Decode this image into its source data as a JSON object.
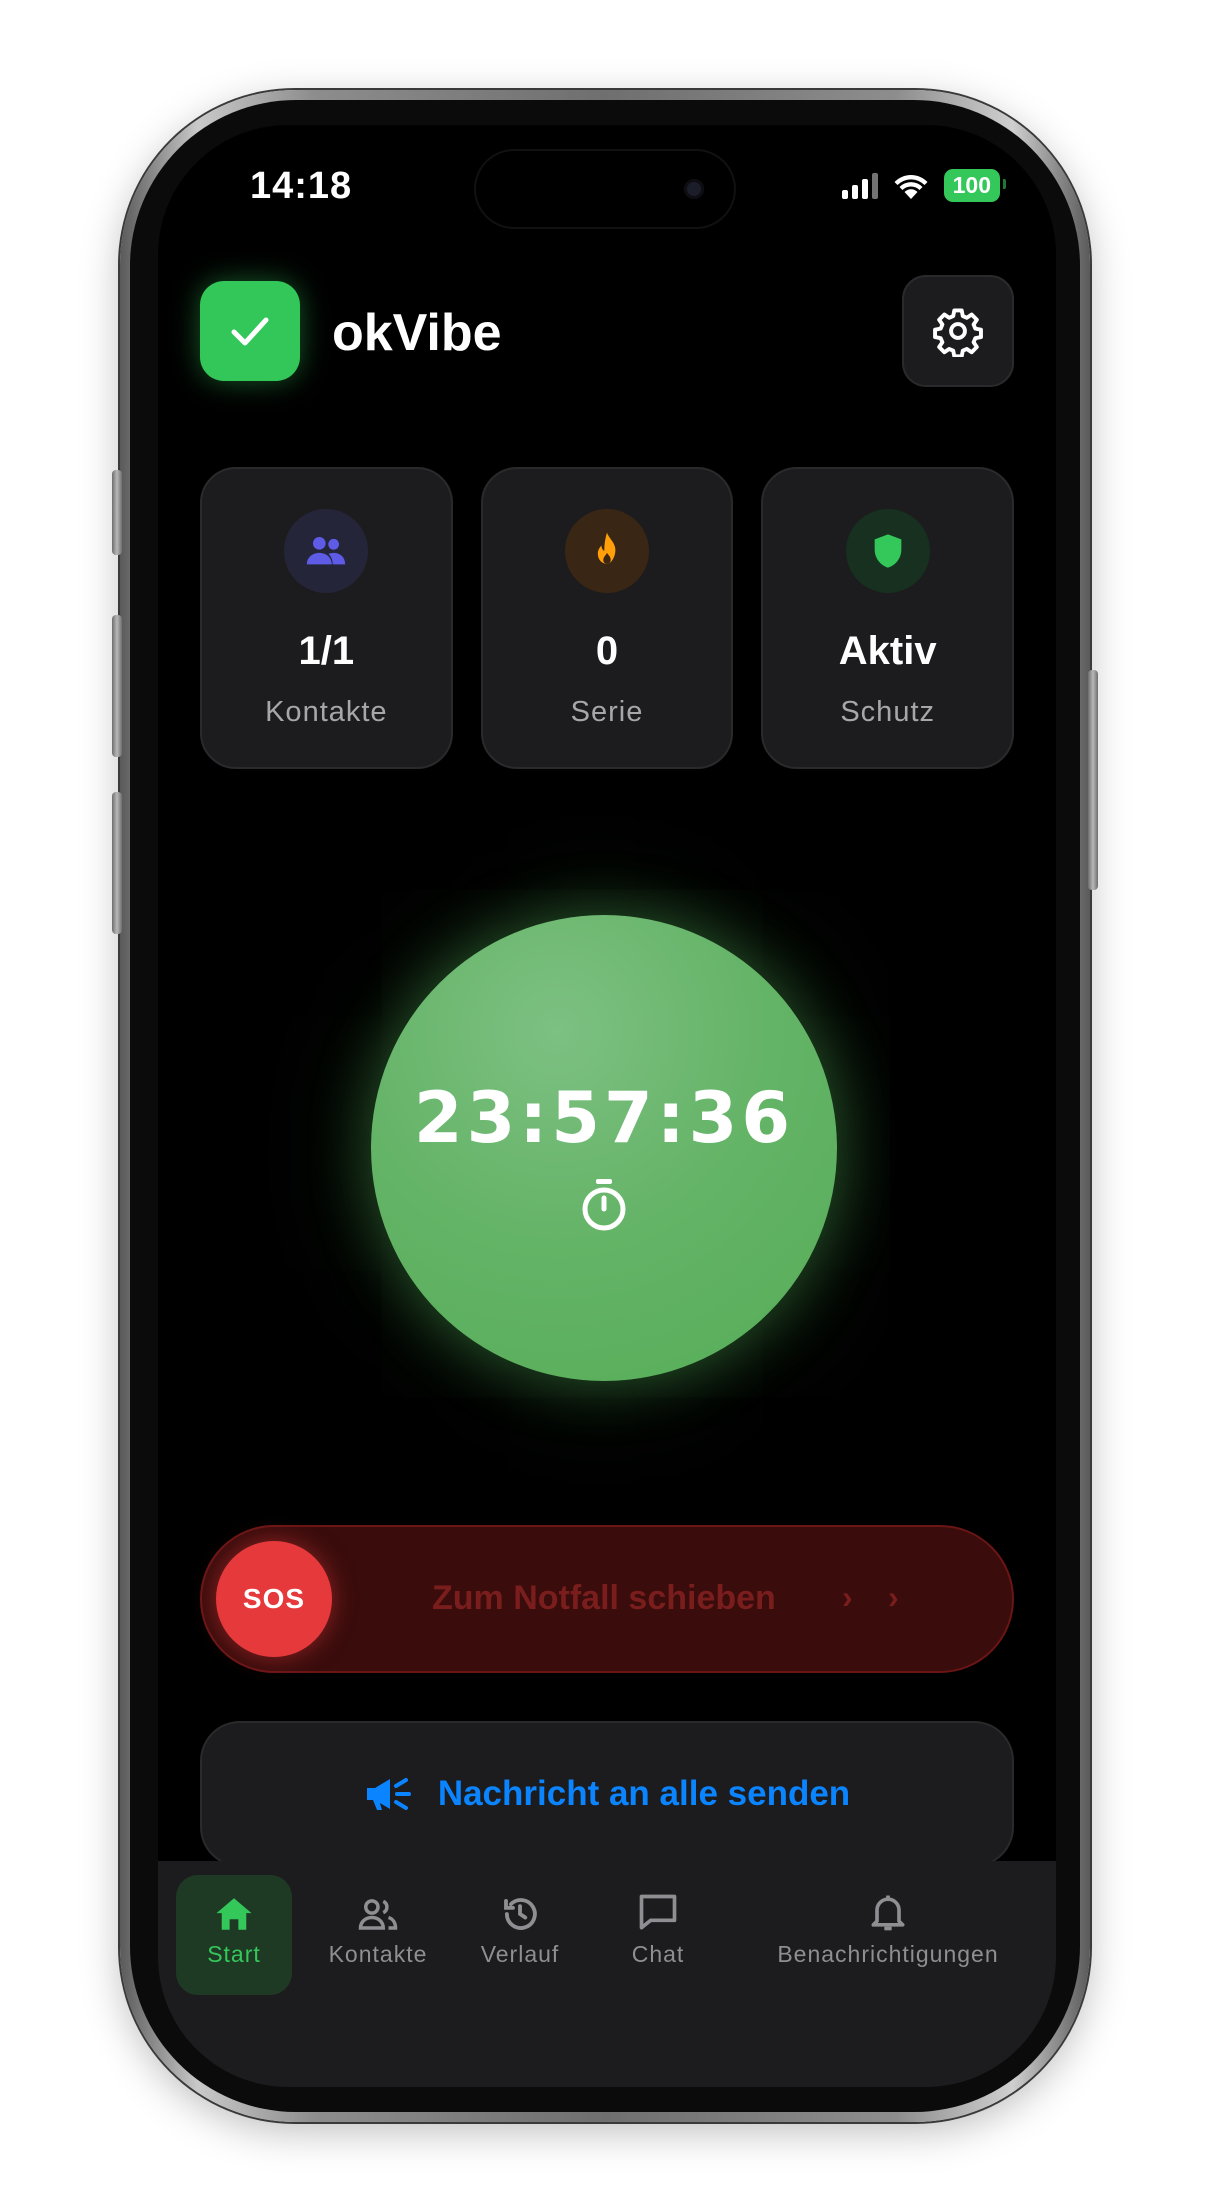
{
  "status_bar": {
    "time": "14:18",
    "battery": "100"
  },
  "header": {
    "app_name": "okVibe"
  },
  "stats": [
    {
      "value": "1/1",
      "label": "Kontakte",
      "icon": "people-icon"
    },
    {
      "value": "0",
      "label": "Serie",
      "icon": "flame-icon"
    },
    {
      "value": "Aktiv",
      "label": "Schutz",
      "icon": "shield-icon"
    }
  ],
  "timer": {
    "countdown": "23:57:36"
  },
  "sos": {
    "knob_label": "SOS",
    "slide_label": "Zum Notfall schieben"
  },
  "broadcast": {
    "label": "Nachricht an alle senden"
  },
  "tabs": [
    {
      "label": "Start",
      "icon": "home-icon",
      "active": true
    },
    {
      "label": "Kontakte",
      "icon": "contacts-icon",
      "active": false
    },
    {
      "label": "Verlauf",
      "icon": "history-icon",
      "active": false
    },
    {
      "label": "Chat",
      "icon": "chat-icon",
      "active": false
    },
    {
      "label": "Benachrichtigungen",
      "icon": "bell-icon",
      "active": false
    }
  ],
  "colors": {
    "accent_green": "#34c759",
    "sos_red": "#e5393b",
    "link_blue": "#0a84ff",
    "streak_orange": "#ff9f0a",
    "contacts_purple": "#5e5ce6"
  }
}
